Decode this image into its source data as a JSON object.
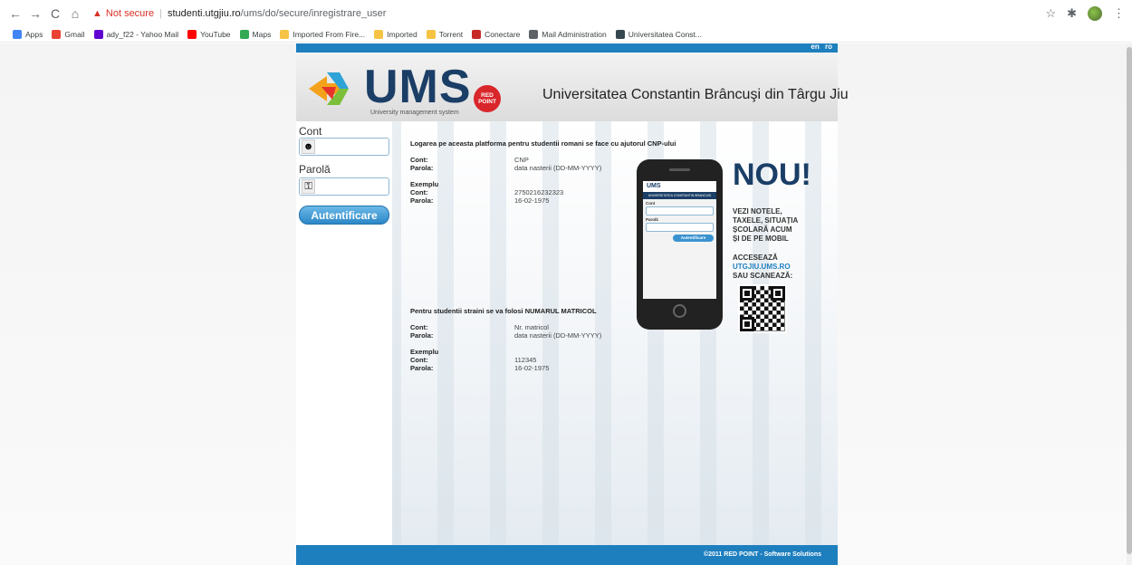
{
  "browser": {
    "nav": {
      "back": "←",
      "forward": "→",
      "reload": "C",
      "home": "⌂"
    },
    "warning_icon": "▲",
    "not_secure": "Not secure",
    "separator": "|",
    "url_host": "studenti.utgjiu.ro",
    "url_path": "/ums/do/secure/inregistrare_user",
    "right_icons": {
      "star": "☆",
      "extensions": "✱",
      "menu": "⋮"
    }
  },
  "bookmarks": [
    {
      "label": "Apps",
      "icon": "apps-icon",
      "color": "#4285f4"
    },
    {
      "label": "Gmail",
      "icon": "gmail-icon",
      "color": "#ea4335"
    },
    {
      "label": "ady_f22 - Yahoo Mail",
      "icon": "yahoo-icon",
      "color": "#6001d2"
    },
    {
      "label": "YouTube",
      "icon": "youtube-icon",
      "color": "#ff0000"
    },
    {
      "label": "Maps",
      "icon": "maps-icon",
      "color": "#34a853"
    },
    {
      "label": "Imported From Fire...",
      "icon": "folder-icon",
      "color": "#f6c344"
    },
    {
      "label": "Imported",
      "icon": "folder-icon",
      "color": "#f6c344"
    },
    {
      "label": "Torrent",
      "icon": "folder-icon",
      "color": "#f6c344"
    },
    {
      "label": "Conectare",
      "icon": "conectare-icon",
      "color": "#c62828"
    },
    {
      "label": "Mail Administration",
      "icon": "globe-icon",
      "color": "#5f6368"
    },
    {
      "label": "Universitatea Const...",
      "icon": "university-icon",
      "color": "#37474f"
    }
  ],
  "lang": {
    "en": "en",
    "ro": "ro"
  },
  "header": {
    "brand": "UMS",
    "brand_sub": "University management system",
    "redpoint": "RED POINT",
    "university": "Universitatea Constantin Brâncuşi din Târgu Jiu"
  },
  "login": {
    "cont_label": "Cont",
    "parola_label": "Parolă",
    "button": "Autentificare"
  },
  "info_ro": {
    "title": "Logarea pe aceasta platforma pentru studentii romani se face cu ajutorul CNP-ului",
    "cont_key": "Cont:",
    "cont_val": "CNP",
    "parola_key": "Parola:",
    "parola_val": "data nasterii (DD-MM-YYYY)",
    "example": "Exemplu",
    "ex_cont_key": "Cont:",
    "ex_cont_val": "2750216232323",
    "ex_parola_key": "Parola:",
    "ex_parola_val": "16-02-1975"
  },
  "info_foreign": {
    "title": "Pentru studentii straini se va folosi NUMARUL MATRICOL",
    "cont_key": "Cont:",
    "cont_val": "Nr. matricol",
    "parola_key": "Parola:",
    "parola_val": "data nasterii (DD-MM-YYYY)",
    "example": "Exemplu",
    "ex_cont_key": "Cont:",
    "ex_cont_val": "112345",
    "ex_parola_key": "Parola:",
    "ex_parola_val": "16-02-1975"
  },
  "ad": {
    "phone_brand": "UMS",
    "phone_univ": "UNIVERSITATEA CONSTANTIN BRANCUSI",
    "phone_cont": "Cont",
    "phone_parola": "Parolă",
    "phone_btn": "Autentificare",
    "nou": "NOU!",
    "line1": "VEZI NOTELE,",
    "line2": "TAXELE, SITUAȚIA",
    "line3": "ȘCOLARĂ ACUM",
    "line4": "ȘI DE PE MOBIL",
    "line5": "ACCESEAZĂ",
    "line6": "UTGJIU.UMS.RO",
    "line7": "SAU SCANEAZĂ:"
  },
  "footer": "©2011 RED POINT - Software Solutions",
  "colors": {
    "accent": "#1e7fbf",
    "brand": "#1a3e66",
    "warning": "#d93025"
  }
}
